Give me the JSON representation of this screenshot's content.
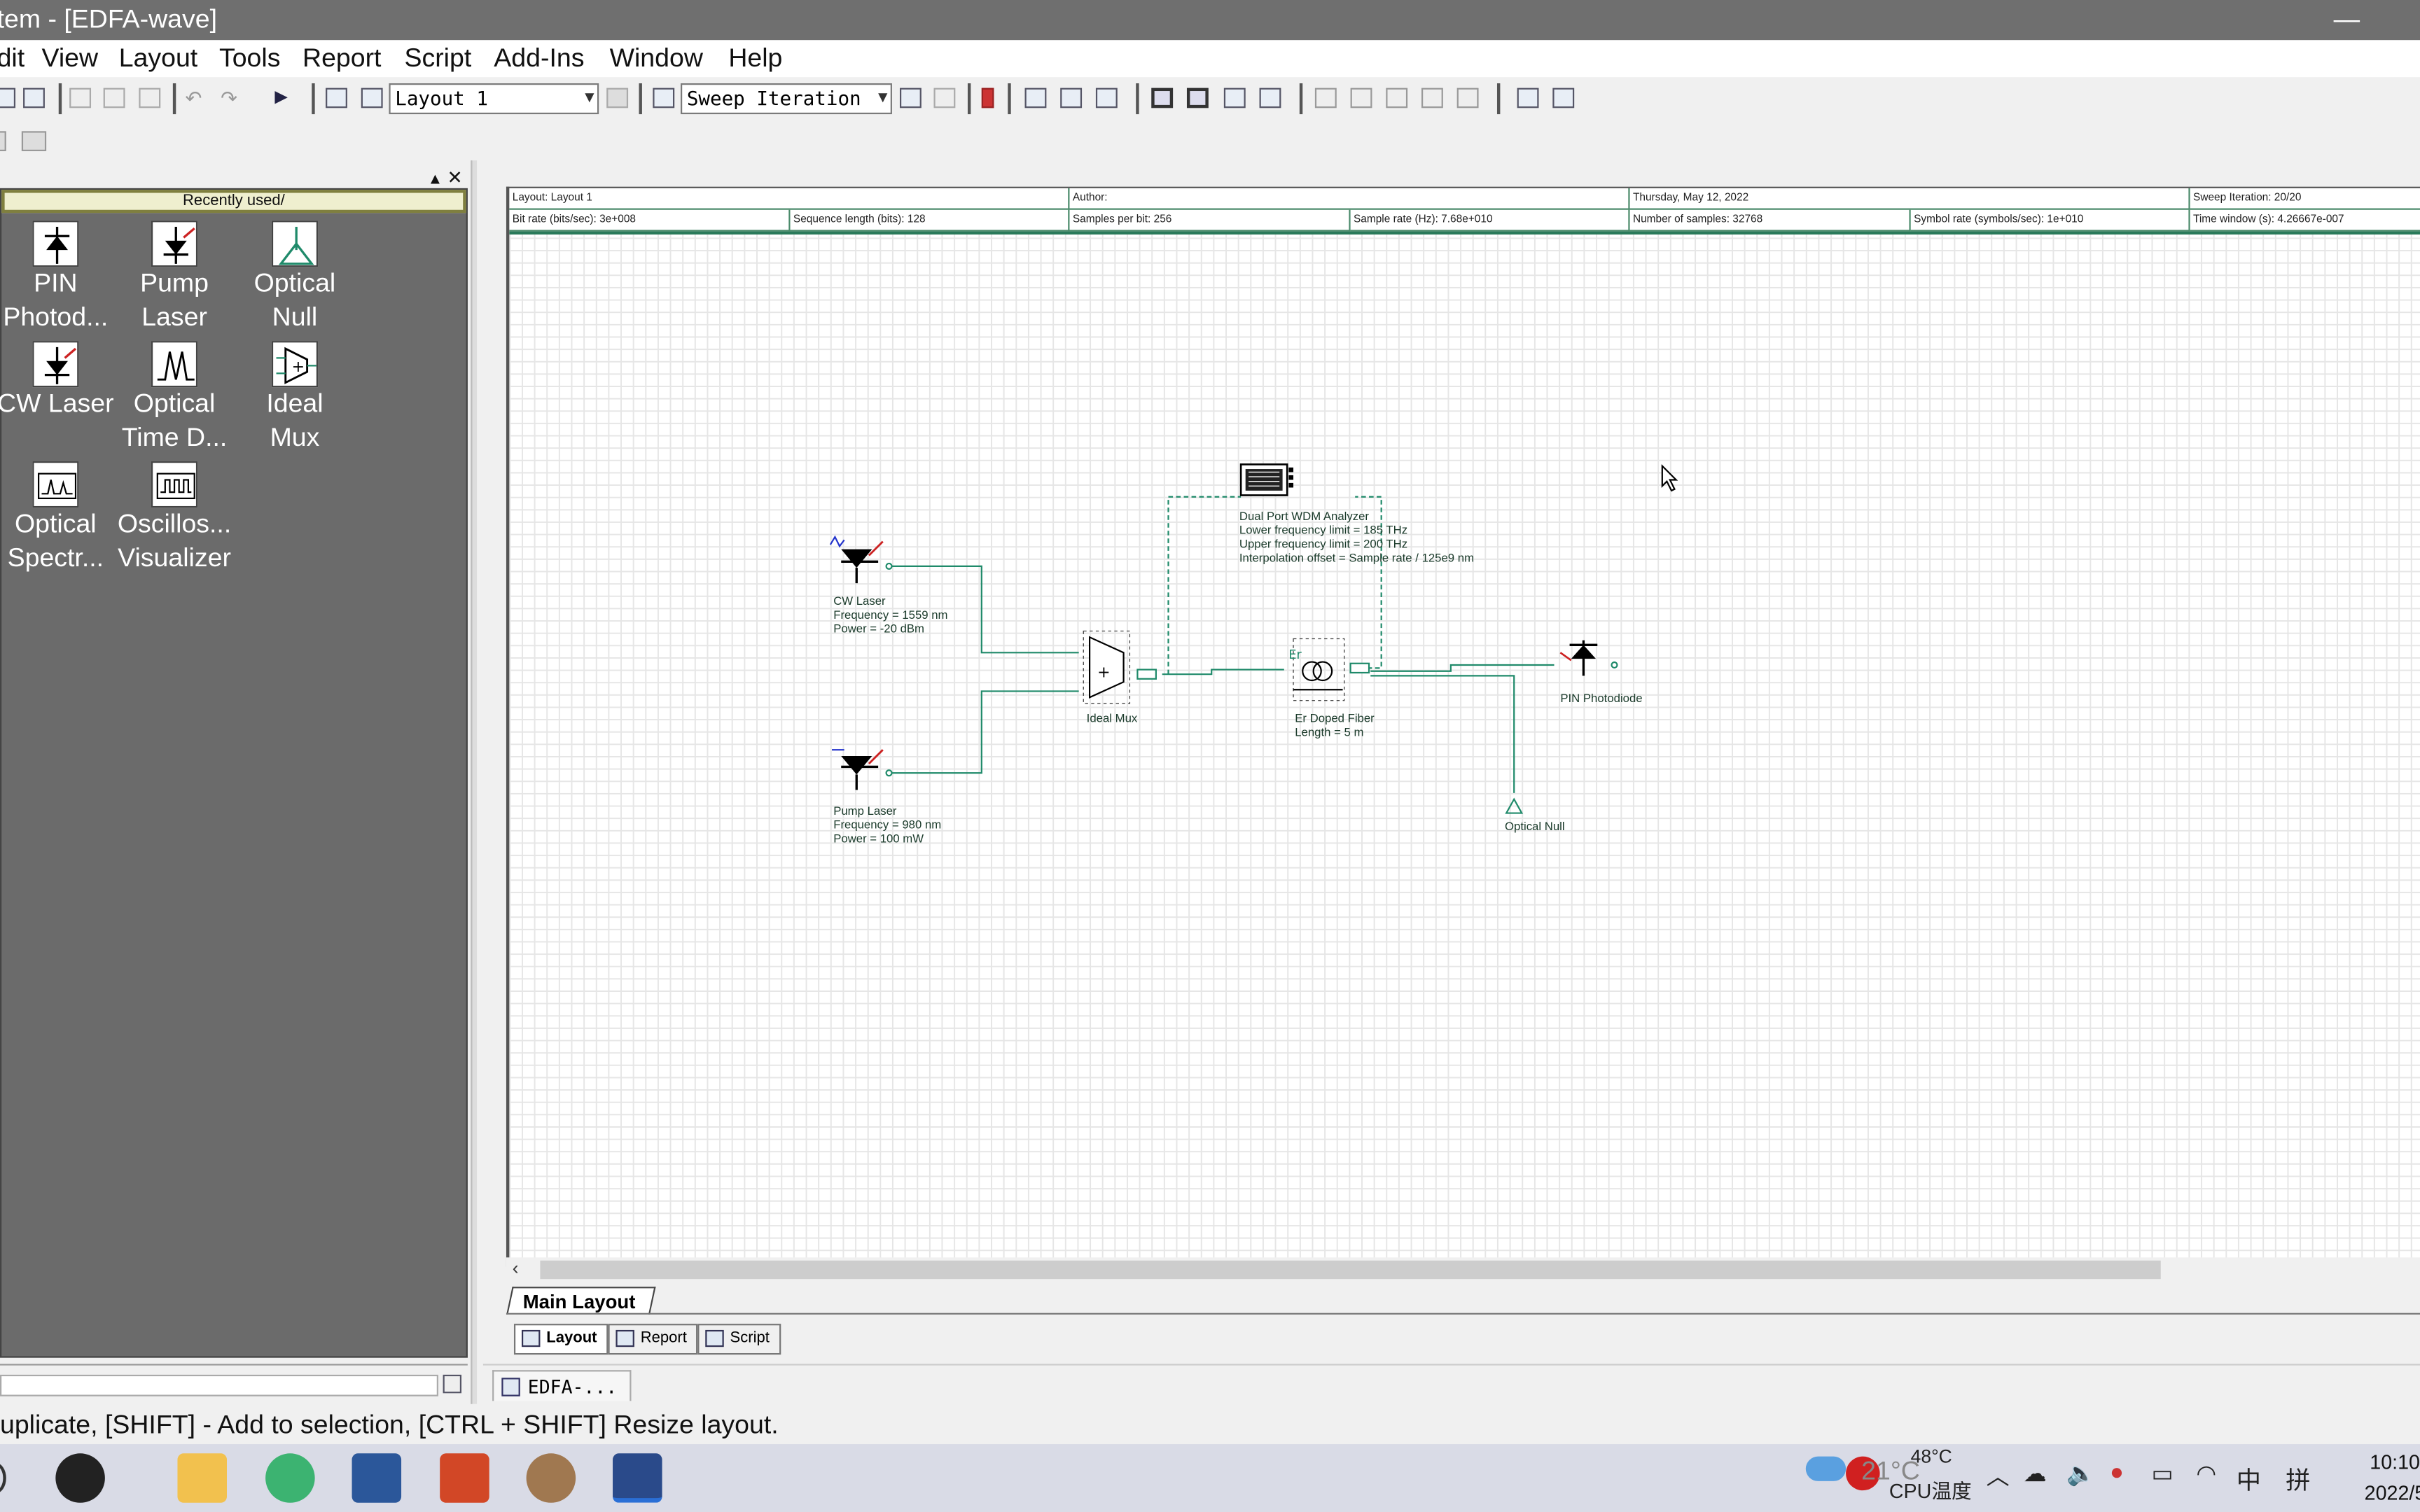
{
  "window": {
    "title": "tem - [EDFA-wave]",
    "minimize": "—"
  },
  "menu": [
    "dit",
    "View",
    "Layout",
    "Tools",
    "Report",
    "Script",
    "Add-Ins",
    "Window",
    "Help"
  ],
  "toolbar": {
    "layout_select": "Layout 1",
    "sweep_select": "Sweep Iteration"
  },
  "library": {
    "header": "Recently used/",
    "items": [
      {
        "label1": "PIN",
        "label2": "Photod..."
      },
      {
        "label1": "Pump",
        "label2": "Laser"
      },
      {
        "label1": "Optical",
        "label2": "Null"
      },
      {
        "label1": "CW Laser",
        "label2": ""
      },
      {
        "label1": "Optical",
        "label2": "Time D..."
      },
      {
        "label1": "Ideal",
        "label2": "Mux"
      },
      {
        "label1": "Optical",
        "label2": "Spectr..."
      },
      {
        "label1": "Oscillos...",
        "label2": "Visualizer"
      }
    ]
  },
  "info": {
    "layout": "Layout: Layout 1",
    "author": "Author:",
    "date": "Thursday, May 12, 2022",
    "sweep": "Sweep Iteration: 20/20",
    "bitrate": "Bit rate (bits/sec):  3e+008",
    "seqlen": "Sequence length (bits):  128",
    "spb": "Samples per bit:  256",
    "srate": "Sample rate (Hz):  7.68e+010",
    "nsamples": "Number of samples:  32768",
    "symrate": "Symbol rate (symbols/sec):  1e+010",
    "timewin": "Time window (s):  4.26667e-007"
  },
  "components": {
    "cw": {
      "name": "CW Laser",
      "l1": "Frequency = 1559  nm",
      "l2": "Power = -20  dBm"
    },
    "pump": {
      "name": "Pump Laser",
      "l1": "Frequency = 980  nm",
      "l2": "Power = 100  mW"
    },
    "mux": {
      "name": "Ideal Mux"
    },
    "wdm": {
      "name": "Dual Port WDM Analyzer",
      "l1": "Lower frequency limit = 185  THz",
      "l2": "Upper frequency limit = 200  THz",
      "l3": "Interpolation offset = Sample rate / 125e9  nm"
    },
    "edf": {
      "name": "Er Doped Fiber",
      "l1": "Length = 5  m"
    },
    "pin": {
      "name": "PIN Photodiode"
    },
    "null": {
      "name": "Optical Null"
    }
  },
  "tabs": {
    "sheet": "Main Layout",
    "layout": "Layout",
    "report": "Report",
    "script": "Script"
  },
  "doc_tab": "EDFA-...",
  "status": "uplicate, [SHIFT] - Add to selection, [CTRL + SHIFT] Resize layout.",
  "tray": {
    "temp": "48°C",
    "temp_label": "CPU温度",
    "weather": "21°C",
    "ime1": "中",
    "ime2": "拼",
    "time": "10:10",
    "date": "2022/5/"
  },
  "colors": {
    "wire": "#1f8a6a",
    "titlebar": "#6f6f6f",
    "library_bg": "#6b6b6b"
  }
}
